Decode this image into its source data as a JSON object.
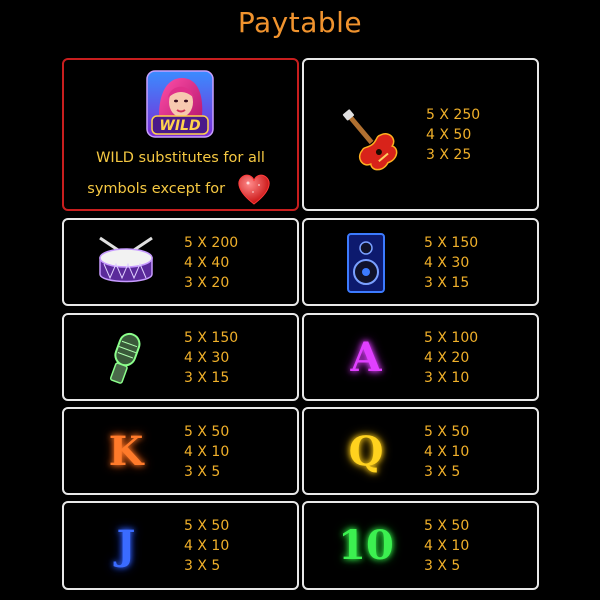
{
  "title": "Paytable",
  "wild": {
    "badge": "WILD",
    "line1": "WILD substitutes for all",
    "line2": "symbols except for"
  },
  "symbols": [
    {
      "name": "guitar",
      "pays": [
        {
          "count": "5",
          "x": "X",
          "value": "250"
        },
        {
          "count": "4",
          "x": "X",
          "value": "50"
        },
        {
          "count": "3",
          "x": "X",
          "value": "25"
        }
      ]
    },
    {
      "name": "drum",
      "pays": [
        {
          "count": "5",
          "x": "X",
          "value": "200"
        },
        {
          "count": "4",
          "x": "X",
          "value": "40"
        },
        {
          "count": "3",
          "x": "X",
          "value": "20"
        }
      ]
    },
    {
      "name": "speaker",
      "pays": [
        {
          "count": "5",
          "x": "X",
          "value": "150"
        },
        {
          "count": "4",
          "x": "X",
          "value": "30"
        },
        {
          "count": "3",
          "x": "X",
          "value": "15"
        }
      ]
    },
    {
      "name": "microphone",
      "pays": [
        {
          "count": "5",
          "x": "X",
          "value": "150"
        },
        {
          "count": "4",
          "x": "X",
          "value": "30"
        },
        {
          "count": "3",
          "x": "X",
          "value": "15"
        }
      ]
    },
    {
      "name": "A",
      "letter": "A",
      "color": "#e040ff",
      "pays": [
        {
          "count": "5",
          "x": "X",
          "value": "100"
        },
        {
          "count": "4",
          "x": "X",
          "value": "20"
        },
        {
          "count": "3",
          "x": "X",
          "value": "10"
        }
      ]
    },
    {
      "name": "K",
      "letter": "K",
      "color": "#ff7a2a",
      "pays": [
        {
          "count": "5",
          "x": "X",
          "value": "50"
        },
        {
          "count": "4",
          "x": "X",
          "value": "10"
        },
        {
          "count": "3",
          "x": "X",
          "value": "5"
        }
      ]
    },
    {
      "name": "Q",
      "letter": "Q",
      "color": "#ffd21e",
      "pays": [
        {
          "count": "5",
          "x": "X",
          "value": "50"
        },
        {
          "count": "4",
          "x": "X",
          "value": "10"
        },
        {
          "count": "3",
          "x": "X",
          "value": "5"
        }
      ]
    },
    {
      "name": "J",
      "letter": "J",
      "color": "#3a6bff",
      "pays": [
        {
          "count": "5",
          "x": "X",
          "value": "50"
        },
        {
          "count": "4",
          "x": "X",
          "value": "10"
        },
        {
          "count": "3",
          "x": "X",
          "value": "5"
        }
      ]
    },
    {
      "name": "10",
      "letter": "10",
      "color": "#3cf050",
      "pays": [
        {
          "count": "5",
          "x": "X",
          "value": "50"
        },
        {
          "count": "4",
          "x": "X",
          "value": "10"
        },
        {
          "count": "3",
          "x": "X",
          "value": "5"
        }
      ]
    }
  ]
}
